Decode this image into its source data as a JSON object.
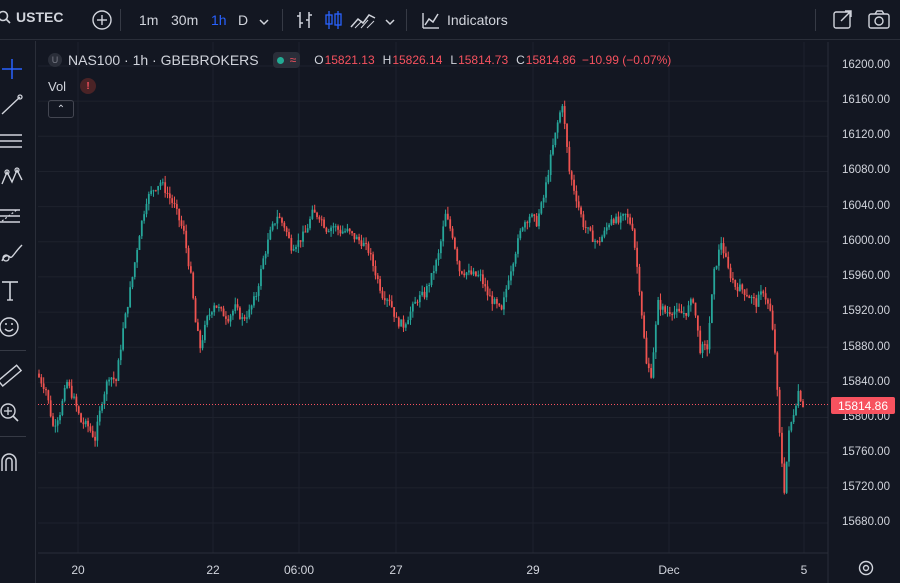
{
  "toolbar": {
    "symbol": "USTEC",
    "intervals": [
      "1m",
      "30m",
      "1h",
      "D"
    ],
    "active_interval": "1h",
    "indicators_label": "Indicators"
  },
  "legend": {
    "title": "NAS100 · 1h · GBEBROKERS",
    "sym_badge": "U",
    "market_status": "≈",
    "ohlc": {
      "o_label": "O",
      "o": "15821.13",
      "h_label": "H",
      "h": "15826.14",
      "l_label": "L",
      "l": "15814.73",
      "c_label": "C",
      "c": "15814.86",
      "change": "−10.99 (−0.07%)"
    },
    "vol_label": "Vol",
    "warn": "!",
    "collapse": "⌃"
  },
  "colors": {
    "up": "#26a69a",
    "down": "#ef5350",
    "bg": "#131722",
    "accent": "#2962ff"
  },
  "price_axis": {
    "labels": [
      "16200.00",
      "16160.00",
      "16120.00",
      "16080.00",
      "16040.00",
      "16000.00",
      "15960.00",
      "15920.00",
      "15880.00",
      "15840.00",
      "15800.00",
      "15760.00",
      "15720.00",
      "15680.00"
    ],
    "last_price": "15814.86"
  },
  "time_axis": {
    "labels": [
      "20",
      "22",
      "06:00",
      "27",
      "29",
      "Dec",
      "5"
    ]
  },
  "icons": [
    "search-icon",
    "add-symbol-icon",
    "chevron-down-icon",
    "bar-style-icon",
    "candles-icon",
    "area-icon",
    "indicators-icon",
    "fullscreen-icon",
    "camera-icon",
    "crosshair-icon",
    "trend-line-icon",
    "horizontal-lines-icon",
    "pattern-icon",
    "fib-icon",
    "brush-icon",
    "text-icon",
    "emoji-icon",
    "ruler-icon",
    "zoom-icon",
    "magnet-icon",
    "settings-icon"
  ],
  "chart_data": {
    "type": "candlestick",
    "symbol": "NAS100",
    "interval": "1h",
    "ylim": [
      15660,
      16220
    ],
    "waypoints": [
      [
        0,
        15846
      ],
      [
        3,
        15832
      ],
      [
        6,
        15790
      ],
      [
        9,
        15806
      ],
      [
        12,
        15840
      ],
      [
        15,
        15820
      ],
      [
        18,
        15795
      ],
      [
        21,
        15790
      ],
      [
        24,
        15776
      ],
      [
        27,
        15820
      ],
      [
        30,
        15848
      ],
      [
        33,
        15842
      ],
      [
        36,
        15900
      ],
      [
        40,
        15960
      ],
      [
        43,
        16010
      ],
      [
        46,
        16048
      ],
      [
        49,
        16060
      ],
      [
        52,
        16068
      ],
      [
        55,
        16055
      ],
      [
        58,
        16040
      ],
      [
        62,
        16010
      ],
      [
        65,
        15960
      ],
      [
        67,
        15908
      ],
      [
        69,
        15880
      ],
      [
        72,
        15912
      ],
      [
        75,
        15930
      ],
      [
        78,
        15920
      ],
      [
        81,
        15914
      ],
      [
        84,
        15925
      ],
      [
        87,
        15912
      ],
      [
        90,
        15920
      ],
      [
        93,
        15940
      ],
      [
        96,
        15980
      ],
      [
        99,
        16010
      ],
      [
        102,
        16030
      ],
      [
        105,
        16018
      ],
      [
        108,
        15995
      ],
      [
        111,
        16000
      ],
      [
        114,
        16010
      ],
      [
        117,
        16032
      ],
      [
        120,
        16030
      ],
      [
        123,
        16015
      ],
      [
        126,
        16018
      ],
      [
        129,
        16012
      ],
      [
        132,
        16012
      ],
      [
        135,
        16005
      ],
      [
        138,
        16000
      ],
      [
        141,
        15990
      ],
      [
        144,
        15965
      ],
      [
        147,
        15940
      ],
      [
        150,
        15935
      ],
      [
        153,
        15910
      ],
      [
        156,
        15905
      ],
      [
        159,
        15920
      ],
      [
        162,
        15935
      ],
      [
        165,
        15940
      ],
      [
        168,
        15960
      ],
      [
        171,
        15985
      ],
      [
        174,
        16030
      ],
      [
        177,
        16008
      ],
      [
        180,
        15968
      ],
      [
        183,
        15965
      ],
      [
        186,
        15962
      ],
      [
        189,
        15960
      ],
      [
        192,
        15940
      ],
      [
        195,
        15930
      ],
      [
        198,
        15920
      ],
      [
        201,
        15960
      ],
      [
        204,
        15990
      ],
      [
        207,
        16020
      ],
      [
        210,
        16030
      ],
      [
        213,
        16022
      ],
      [
        216,
        16050
      ],
      [
        219,
        16095
      ],
      [
        222,
        16135
      ],
      [
        224,
        16158
      ],
      [
        227,
        16080
      ],
      [
        230,
        16050
      ],
      [
        233,
        16020
      ],
      [
        236,
        16008
      ],
      [
        239,
        15998
      ],
      [
        242,
        16010
      ],
      [
        245,
        16028
      ],
      [
        248,
        16022
      ],
      [
        251,
        16030
      ],
      [
        254,
        16018
      ],
      [
        257,
        15948
      ],
      [
        260,
        15860
      ],
      [
        262,
        15850
      ],
      [
        265,
        15930
      ],
      [
        268,
        15920
      ],
      [
        271,
        15922
      ],
      [
        274,
        15918
      ],
      [
        277,
        15920
      ],
      [
        280,
        15935
      ],
      [
        283,
        15878
      ],
      [
        286,
        15880
      ],
      [
        289,
        15965
      ],
      [
        292,
        16000
      ],
      [
        295,
        15968
      ],
      [
        298,
        15950
      ],
      [
        301,
        15946
      ],
      [
        304,
        15938
      ],
      [
        307,
        15930
      ],
      [
        310,
        15945
      ],
      [
        313,
        15920
      ],
      [
        315,
        15875
      ],
      [
        317,
        15780
      ],
      [
        319,
        15718
      ],
      [
        321,
        15782
      ],
      [
        323,
        15806
      ],
      [
        325,
        15830
      ],
      [
        327,
        15815
      ]
    ]
  }
}
